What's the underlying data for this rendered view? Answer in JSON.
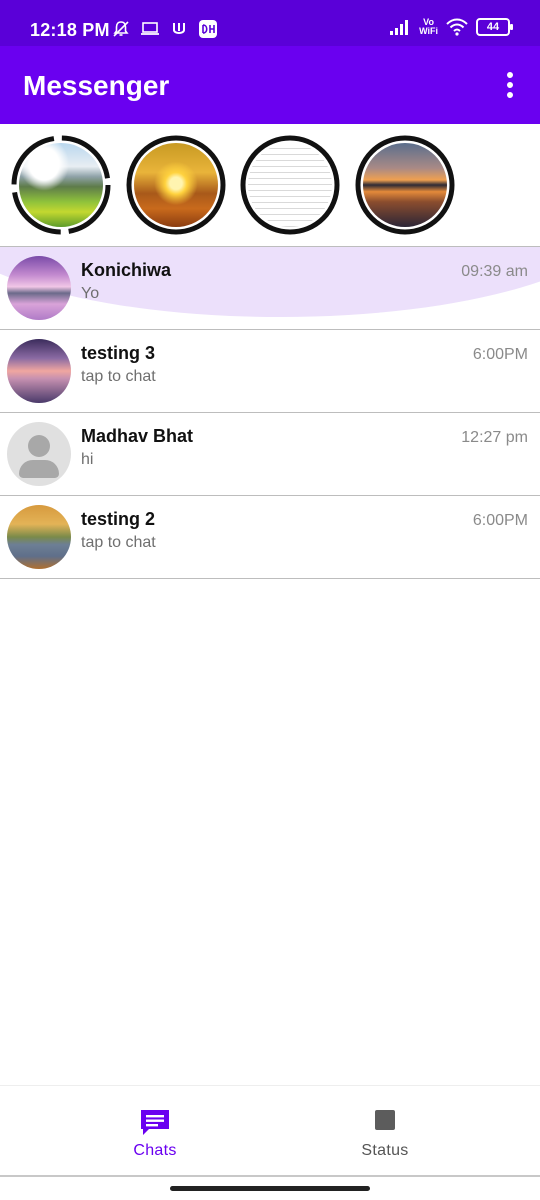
{
  "status_bar": {
    "time": "12:18 PM",
    "volte": "Vo\nWiFi",
    "battery": "44"
  },
  "app_bar": {
    "title": "Messenger"
  },
  "stories": [
    {
      "id": "story-1"
    },
    {
      "id": "story-2"
    },
    {
      "id": "story-3"
    },
    {
      "id": "story-4"
    }
  ],
  "chats": [
    {
      "name": "Konichiwa",
      "message": "Yo",
      "time": "09:39 am"
    },
    {
      "name": "testing 3",
      "message": "tap to chat",
      "time": "6:00PM"
    },
    {
      "name": "Madhav Bhat",
      "message": "hi",
      "time": "12:27 pm"
    },
    {
      "name": "testing 2",
      "message": "tap to chat",
      "time": "6:00PM"
    }
  ],
  "bottom_nav": {
    "chats_label": "Chats",
    "status_label": "Status"
  },
  "colors": {
    "status_bar": "#5a00d8",
    "app_bar": "#6a00f0",
    "accent": "#6a00f0",
    "ripple": "#ece0fb"
  }
}
